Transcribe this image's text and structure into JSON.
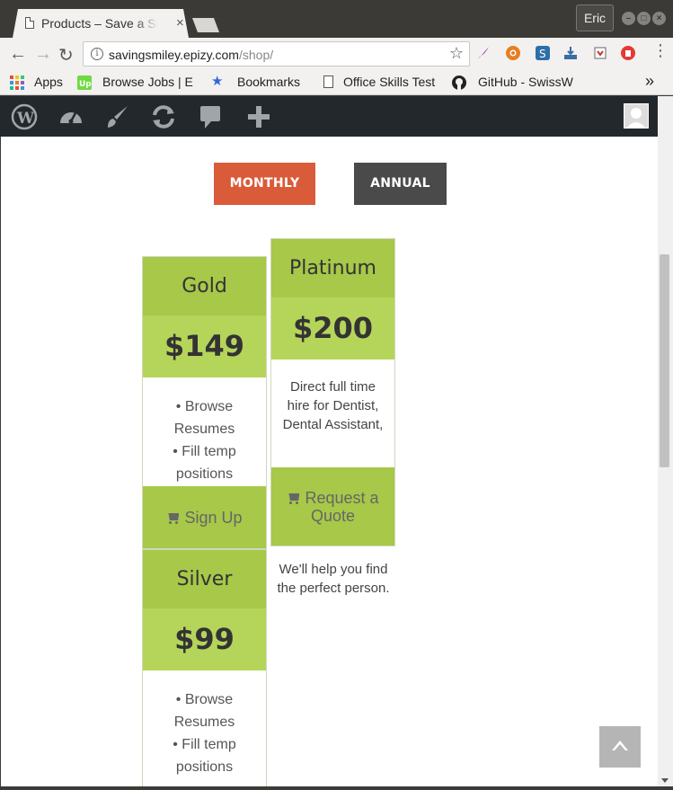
{
  "browser": {
    "tab_title": "Products – Save a Smile",
    "tab_close": "×",
    "profile_name": "Eric",
    "url_host": "savingsmiley.epizy.com",
    "url_path": "/shop/",
    "bookmarks": [
      {
        "label": "Apps",
        "icon": "apps-grid-icon"
      },
      {
        "label": "Browse Jobs | E",
        "icon": "upwork-icon"
      },
      {
        "label": "Bookmarks",
        "icon": "star-icon"
      },
      {
        "label": "Office Skills Test",
        "icon": "page-icon"
      },
      {
        "label": "GitHub - SwissW",
        "icon": "github-icon"
      }
    ],
    "overflow": "»"
  },
  "colors": {
    "monthly_button": "#d95b3a",
    "annual_button": "#4a4a4a",
    "card_header": "#a7c849",
    "card_price": "#b5d55a",
    "admin_bar": "#23282d"
  },
  "pricing": {
    "toggle": {
      "monthly": "MONTHLY",
      "annual": "ANNUAL"
    },
    "gold": {
      "name": "Gold",
      "price": "$149",
      "features": [
        "• Browse Resumes",
        "• Fill temp positions"
      ],
      "cta": "Sign Up"
    },
    "platinum": {
      "name": "Platinum",
      "price": "$200",
      "description": "Direct full time hire for Dentist, Dental Assistant,",
      "cta": "Request a Quote",
      "note": "We'll help you find the perfect person."
    },
    "silver": {
      "name": "Silver",
      "price": "$99",
      "features": [
        "• Browse Resumes",
        "• Fill temp positions"
      ]
    }
  }
}
